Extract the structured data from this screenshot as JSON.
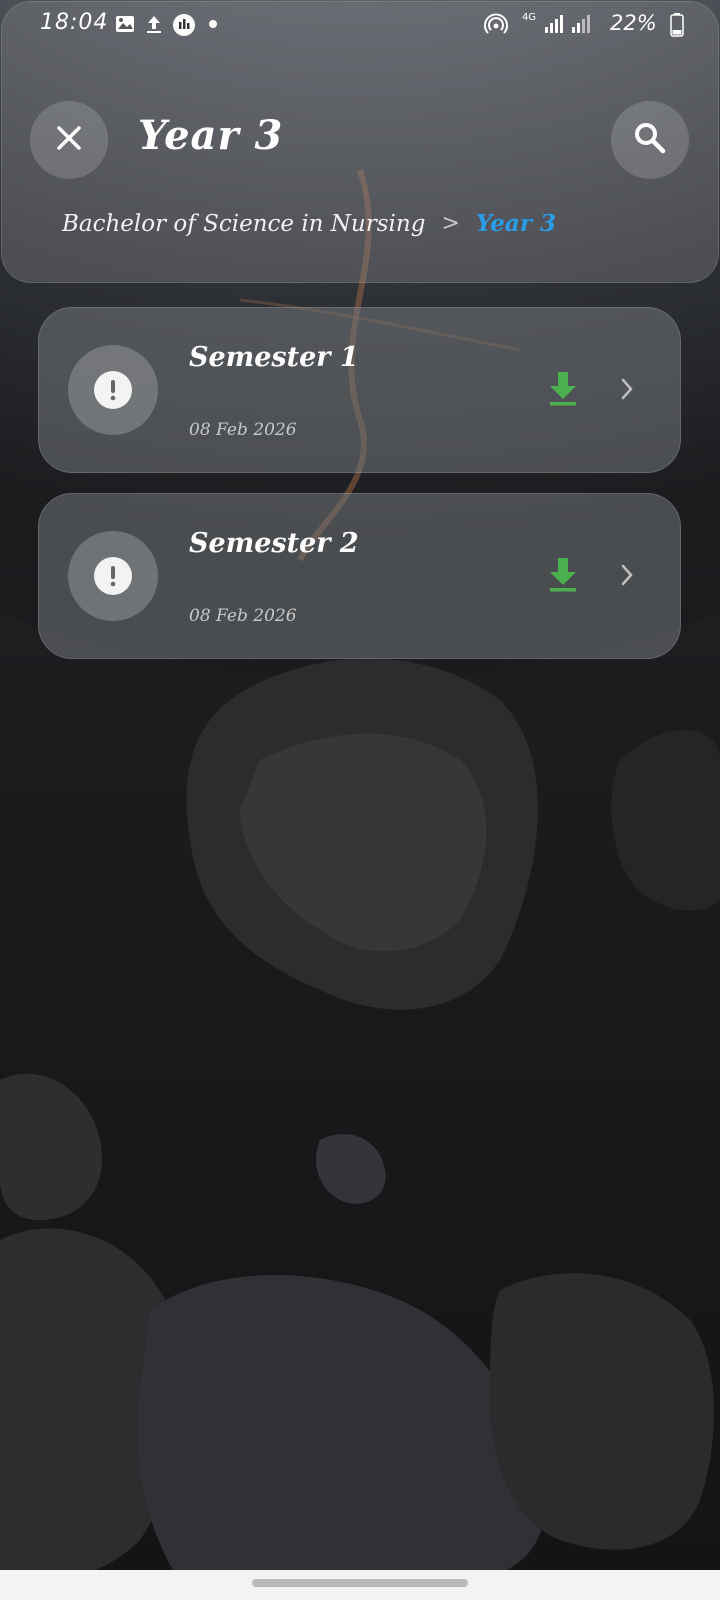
{
  "status_bar": {
    "time": "18:04",
    "battery": "22%",
    "network": "4G"
  },
  "header": {
    "title": "Year 3",
    "breadcrumb": {
      "parent": "Bachelor of Science in Nursing",
      "separator": ">",
      "current": "Year 3"
    }
  },
  "items": [
    {
      "title": "Semester 1",
      "date": "08 Feb 2026"
    },
    {
      "title": "Semester 2",
      "date": "08 Feb 2026"
    }
  ],
  "colors": {
    "accent": "#2a9de8",
    "download": "#4caf50"
  },
  "icons": {
    "close": "close-icon",
    "search": "search-icon",
    "alert": "alert-icon",
    "download": "download-icon",
    "chevron": "chevron-right-icon"
  }
}
